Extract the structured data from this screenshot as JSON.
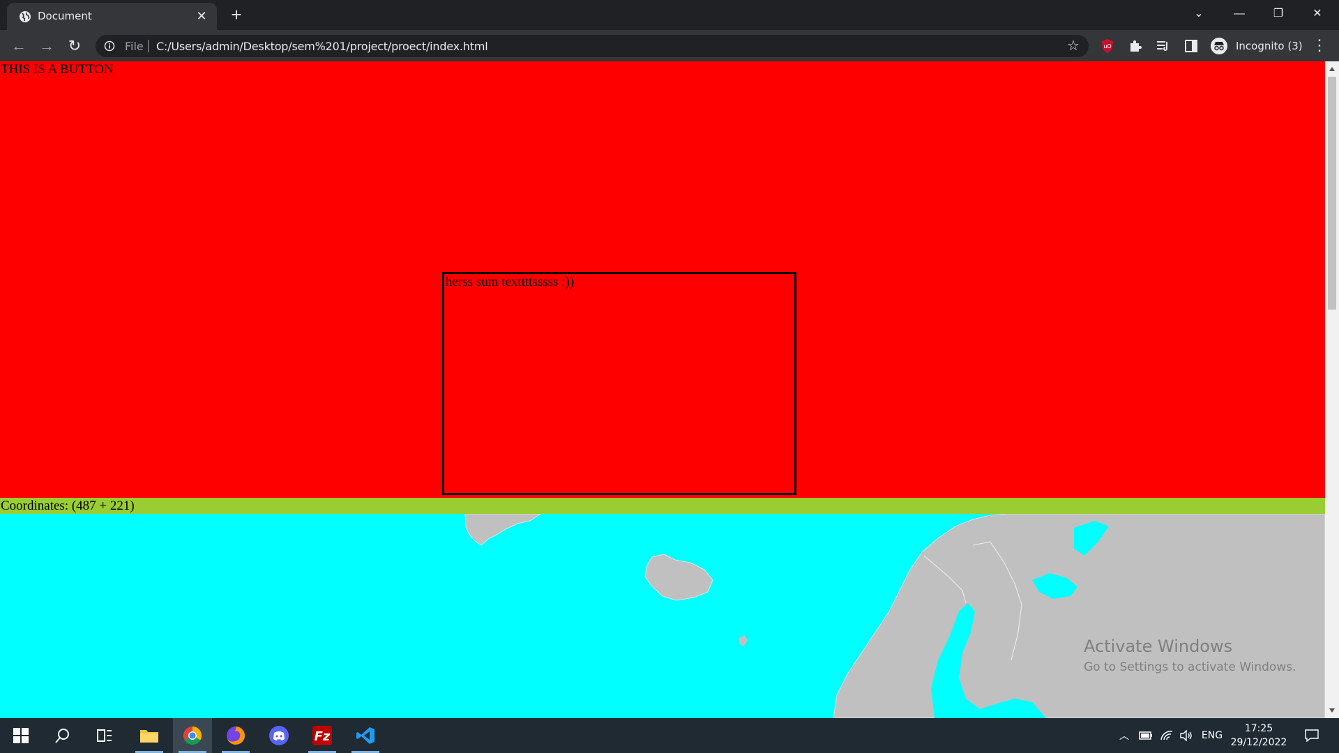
{
  "browser": {
    "tab_title": "Document",
    "address_prefix": "File",
    "url": "C:/Users/admin/Desktop/sem%201/project/proect/index.html",
    "profile_label": "Incognito (3)",
    "icons": {
      "tab_favicon": "globe-icon",
      "close_tab": "close-icon",
      "new_tab": "plus-icon",
      "back": "arrow-left-icon",
      "forward": "arrow-right-icon",
      "reload": "reload-icon",
      "info": "info-icon",
      "bookmark": "star-icon",
      "ublock": "ublock-origin-icon",
      "extensions": "puzzle-icon",
      "reading_list": "reading-list-icon",
      "side_panel": "side-panel-icon",
      "incognito": "incognito-icon",
      "menu": "kebab-menu-icon"
    }
  },
  "page": {
    "button_label": "THIS IS A BUTTON",
    "box_text": "herss sum texttttsssss :))",
    "coordinates_text": "Coordinates: (487 + 221)",
    "watermark_title": "Activate Windows",
    "watermark_subtitle": "Go to Settings to activate Windows."
  },
  "colors": {
    "red_section": "#ff0000",
    "coord_bar": "#9acd32",
    "sea": "#00ffff",
    "land": "#c0c0c0"
  },
  "taskbar": {
    "apps": [
      "windows-start-icon",
      "search-icon",
      "task-view-icon",
      "file-explorer-icon",
      "chrome-icon",
      "firefox-icon",
      "discord-icon",
      "filezilla-icon",
      "vscode-icon"
    ],
    "language": "ENG",
    "time": "17:25",
    "date": "29/12/2022"
  }
}
